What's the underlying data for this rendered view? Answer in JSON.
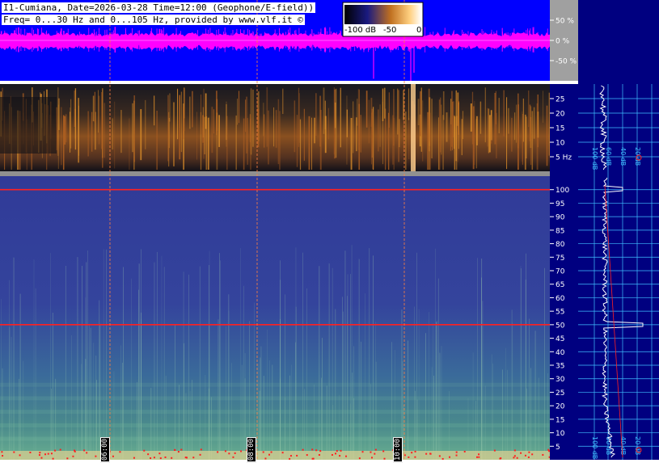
{
  "header": {
    "line1": "I1-Cumiana, Date=2026-03-28 Time=12:00 (Geophone/E-field))",
    "line2": "Freq= 0...30 Hz and 0...105 Hz, provided by www.vlf.it ©"
  },
  "colorbar": {
    "min_label": "-100 dB",
    "mid_label": "-50",
    "max_label": "0"
  },
  "time_markers": [
    "06:00",
    "08:00",
    "10:00"
  ],
  "colors": {
    "amp_bg": "#0000ff",
    "amp_signal": "#ff00ff",
    "panel_gray": "#a0a0a0",
    "right_bg": "#000080",
    "grid": "#40c0ff",
    "marker": "#ff8040",
    "hum_line": "#ff2020"
  },
  "chart_data": [
    {
      "type": "line",
      "title": "",
      "ylabel": "%",
      "ylim": [
        -100,
        100
      ],
      "yticks": [
        "50 %",
        "0 %",
        "-50 %"
      ],
      "ytick_values": [
        50,
        0,
        -50
      ]
    },
    {
      "type": "heatmap",
      "xlabel": "",
      "ylabel": "Hz",
      "ylim": [
        0,
        30
      ],
      "yticks": [
        "25",
        "20",
        "15",
        "10",
        "5 Hz"
      ],
      "ytick_values": [
        25,
        20,
        15,
        10,
        5
      ],
      "colormap": "black-orange-white"
    },
    {
      "type": "heatmap",
      "ylabel": "Hz",
      "ylim": [
        0,
        105
      ],
      "yticks": [
        "100",
        "95",
        "90",
        "85",
        "80",
        "75",
        "70",
        "65",
        "60",
        "55",
        "50",
        "45",
        "40",
        "35",
        "30",
        "25",
        "20",
        "15",
        "10",
        "5"
      ],
      "ytick_values": [
        100,
        95,
        90,
        85,
        80,
        75,
        70,
        65,
        60,
        55,
        50,
        45,
        40,
        35,
        30,
        25,
        20,
        15,
        10,
        5
      ],
      "colormap": "blue-green-white",
      "hum_lines_hz": [
        100,
        50
      ]
    },
    {
      "type": "line",
      "title": "",
      "xticks": [
        "100 dB",
        "60 dB",
        "40 dB",
        "20 dB"
      ],
      "xtick_values": [
        -100,
        -60,
        -40,
        -20
      ],
      "note_labels_upper": [
        "100 dB",
        "60 dB",
        "40 dB",
        "20 dB"
      ]
    }
  ]
}
